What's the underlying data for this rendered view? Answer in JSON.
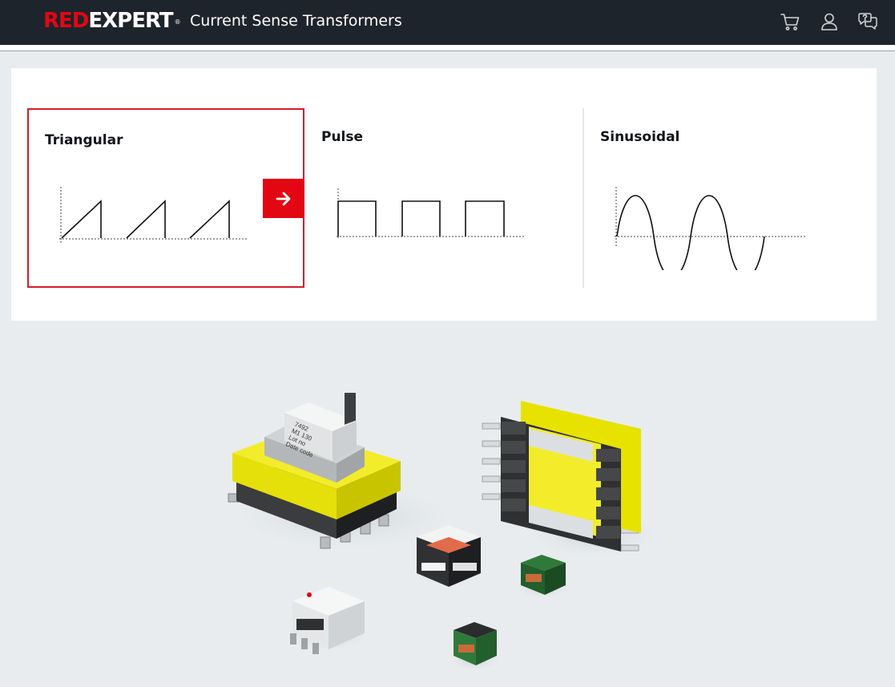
{
  "header": {
    "logo_red": "RED",
    "logo_white": "EXPERT",
    "logo_reg": "®",
    "title": "Current Sense Transformers",
    "icons": [
      "cart-icon",
      "user-icon",
      "help-chat-icon"
    ]
  },
  "waveforms": {
    "selected": "Triangular",
    "cards": [
      {
        "label": "Triangular",
        "icon": "triangular-wave"
      },
      {
        "label": "Pulse",
        "icon": "pulse-wave"
      },
      {
        "label": "Sinusoidal",
        "icon": "sine-wave"
      }
    ],
    "next_icon": "arrow-right-icon"
  },
  "product_image": {
    "marking_lines": [
      "7492",
      "M1 130",
      "Lot no",
      "Date code"
    ]
  },
  "colors": {
    "header_bg": "#1e242b",
    "brand_red": "#e30613",
    "selected_border": "#d51e2a",
    "page_bg": "#e8ecee"
  }
}
